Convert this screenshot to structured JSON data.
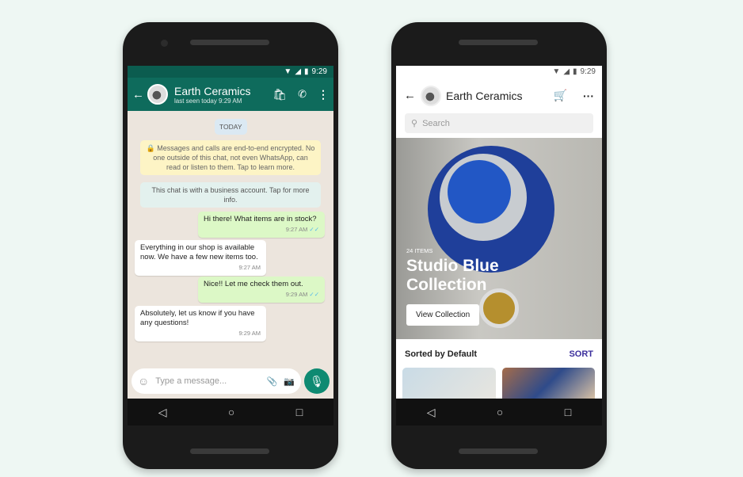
{
  "whatsapp": {
    "status_time": "9:29",
    "contact_name": "Earth Ceramics",
    "last_seen": "last seen today 9:29 AM",
    "date_chip": "TODAY",
    "encryption_notice": "Messages and calls are end-to-end encrypted. No one outside of this chat, not even WhatsApp, can read or listen to them. Tap to learn more.",
    "business_notice": "This chat is with a business account. Tap for more info.",
    "messages": [
      {
        "direction": "sent",
        "text": "Hi there! What items are in stock?",
        "time": "9:27 AM"
      },
      {
        "direction": "received",
        "text": "Everything in our shop is available now. We have a few new items too.",
        "time": "9:27 AM"
      },
      {
        "direction": "sent",
        "text": "Nice!! Let me check them out.",
        "time": "9:29 AM"
      },
      {
        "direction": "received",
        "text": "Absolutely, let us know if you have any questions!",
        "time": "9:29 AM"
      }
    ],
    "input_placeholder": "Type a message...",
    "header_color": "#0e6b5c"
  },
  "catalog": {
    "status_time": "9:29",
    "business_name": "Earth Ceramics",
    "search_placeholder": "Search",
    "hero": {
      "count": "24 ITEMS",
      "title_line1": "Studio Blue",
      "title_line2": "Collection",
      "button": "View Collection"
    },
    "sorted_label": "Sorted by Default",
    "sort_button": "SORT",
    "accent_color": "#3b2e9c"
  }
}
